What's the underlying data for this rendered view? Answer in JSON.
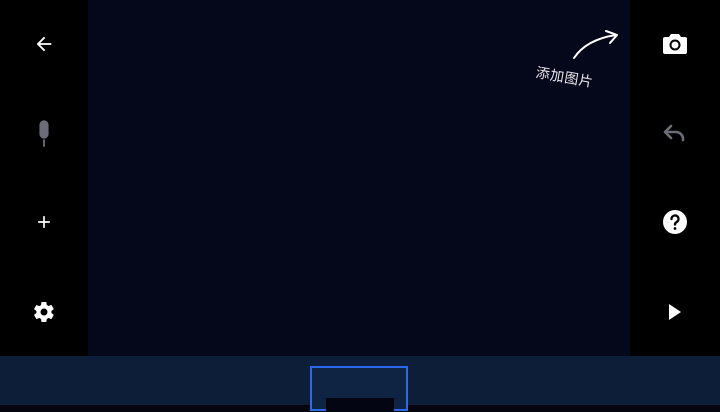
{
  "left_toolbar": {
    "items": [
      {
        "name": "back",
        "icon": "arrow-left-icon"
      },
      {
        "name": "voice",
        "icon": "microphone-icon"
      },
      {
        "name": "add",
        "icon": "plus-icon"
      },
      {
        "name": "settings",
        "icon": "gear-icon"
      }
    ]
  },
  "right_toolbar": {
    "items": [
      {
        "name": "camera",
        "icon": "camera-icon"
      },
      {
        "name": "undo",
        "icon": "undo-icon"
      },
      {
        "name": "help",
        "icon": "help-icon"
      },
      {
        "name": "play",
        "icon": "play-icon"
      }
    ]
  },
  "hint": {
    "label": "添加图片"
  },
  "colors": {
    "canvas": "#05071a",
    "sidebar": "#000000",
    "bottom_bar": "#0d1f38",
    "thumbnail_border": "#2b69ee",
    "icon": "#ffffff",
    "icon_disabled": "#6a6d78"
  }
}
